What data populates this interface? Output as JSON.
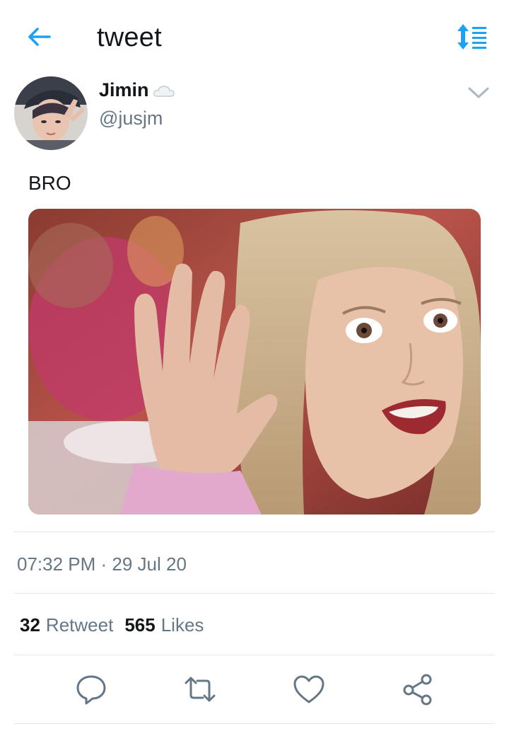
{
  "header": {
    "title": "tweet",
    "back_icon": "arrow-left-icon",
    "sort_icon": "sort-icon",
    "accent_color": "#1da1f2"
  },
  "tweet": {
    "author": {
      "display_name": "Jimin",
      "name_emoji_icon": "cloud-icon",
      "handle": "@jusjm"
    },
    "menu_icon": "chevron-down-icon",
    "text": "BRO",
    "media": {
      "description_icon": "gif-photo"
    },
    "timestamp": "07:32 PM · 29 Jul 20",
    "stats": {
      "retweets_count": "32",
      "retweets_label": "Retweet",
      "likes_count": "565",
      "likes_label": "Likes"
    },
    "actions": [
      {
        "name": "reply",
        "icon": "reply-icon"
      },
      {
        "name": "retweet",
        "icon": "retweet-icon"
      },
      {
        "name": "like",
        "icon": "heart-icon"
      },
      {
        "name": "share",
        "icon": "share-icon"
      }
    ]
  },
  "colors": {
    "text_primary": "#14171a",
    "text_secondary": "#657786",
    "divider": "#e1e8ed",
    "accent": "#1da1f2"
  }
}
